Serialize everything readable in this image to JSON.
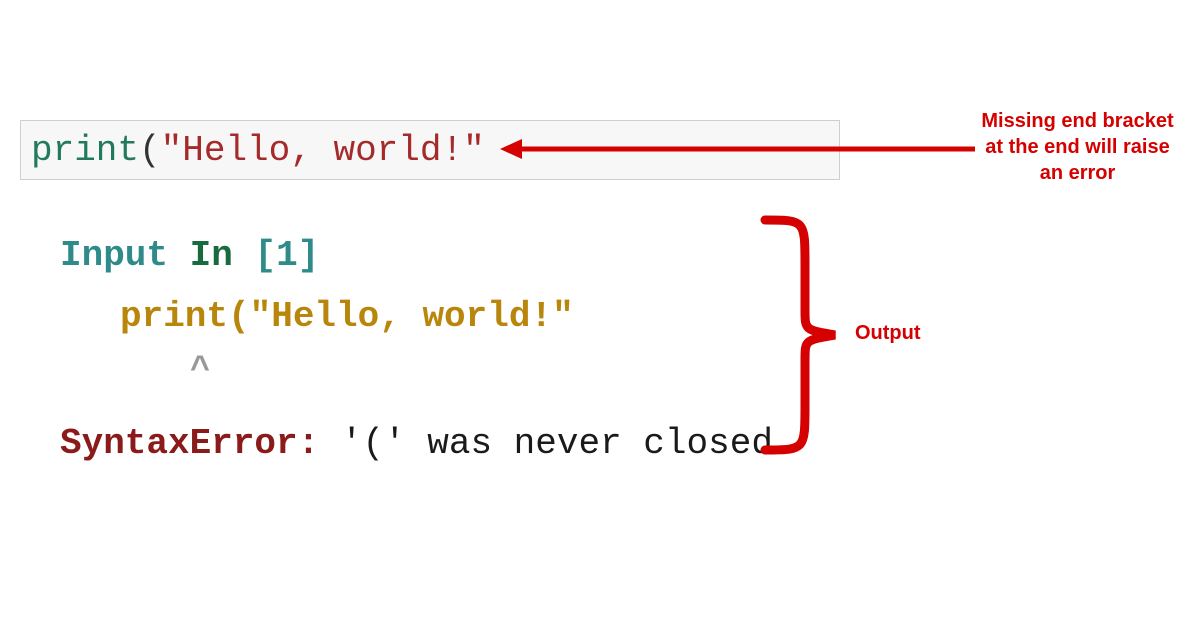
{
  "code_cell": {
    "fn_name": "print",
    "open_paren": "(",
    "string": "\"Hello, world!\""
  },
  "annotation_top": "Missing end bracket at the end will raise an error",
  "output": {
    "input_label_word1": "Input",
    "input_label_word2": "In",
    "input_label_bracket": "[1]",
    "echo_line": "print(\"Hello, world!\"",
    "caret": "^",
    "error_name": "SyntaxError:",
    "error_msg": " '(' was never closed"
  },
  "annotation_output": "Output",
  "colors": {
    "annotation": "#d50000",
    "fn_name": "#227a5c",
    "string": "#a52a2a",
    "input_teal": "#2f8a8a",
    "echo": "#b8860b",
    "error_name": "#8b1a1a"
  }
}
